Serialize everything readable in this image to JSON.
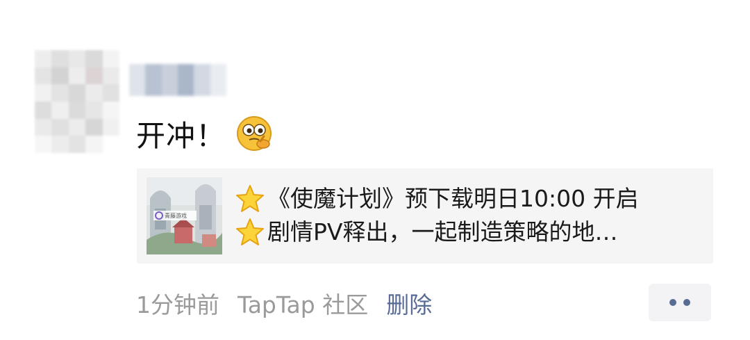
{
  "post": {
    "text": "开冲！",
    "emoji": "thinking-face-emoji"
  },
  "share_card": {
    "thumb_logo_text": "青藤游戏",
    "line1_icon": "star-emoji",
    "line1": "《使魔计划》预下载明日10:00 开启",
    "line2_icon": "star-emoji",
    "line2": "剧情PV释出，一起制造策略的地…"
  },
  "meta": {
    "time": "1分钟前",
    "source": "TapTap 社区",
    "delete_label": "删除"
  },
  "colors": {
    "link": "#576b95",
    "meta_gray": "#9a9a9a",
    "card_bg": "#f5f5f5",
    "text": "#111111"
  }
}
